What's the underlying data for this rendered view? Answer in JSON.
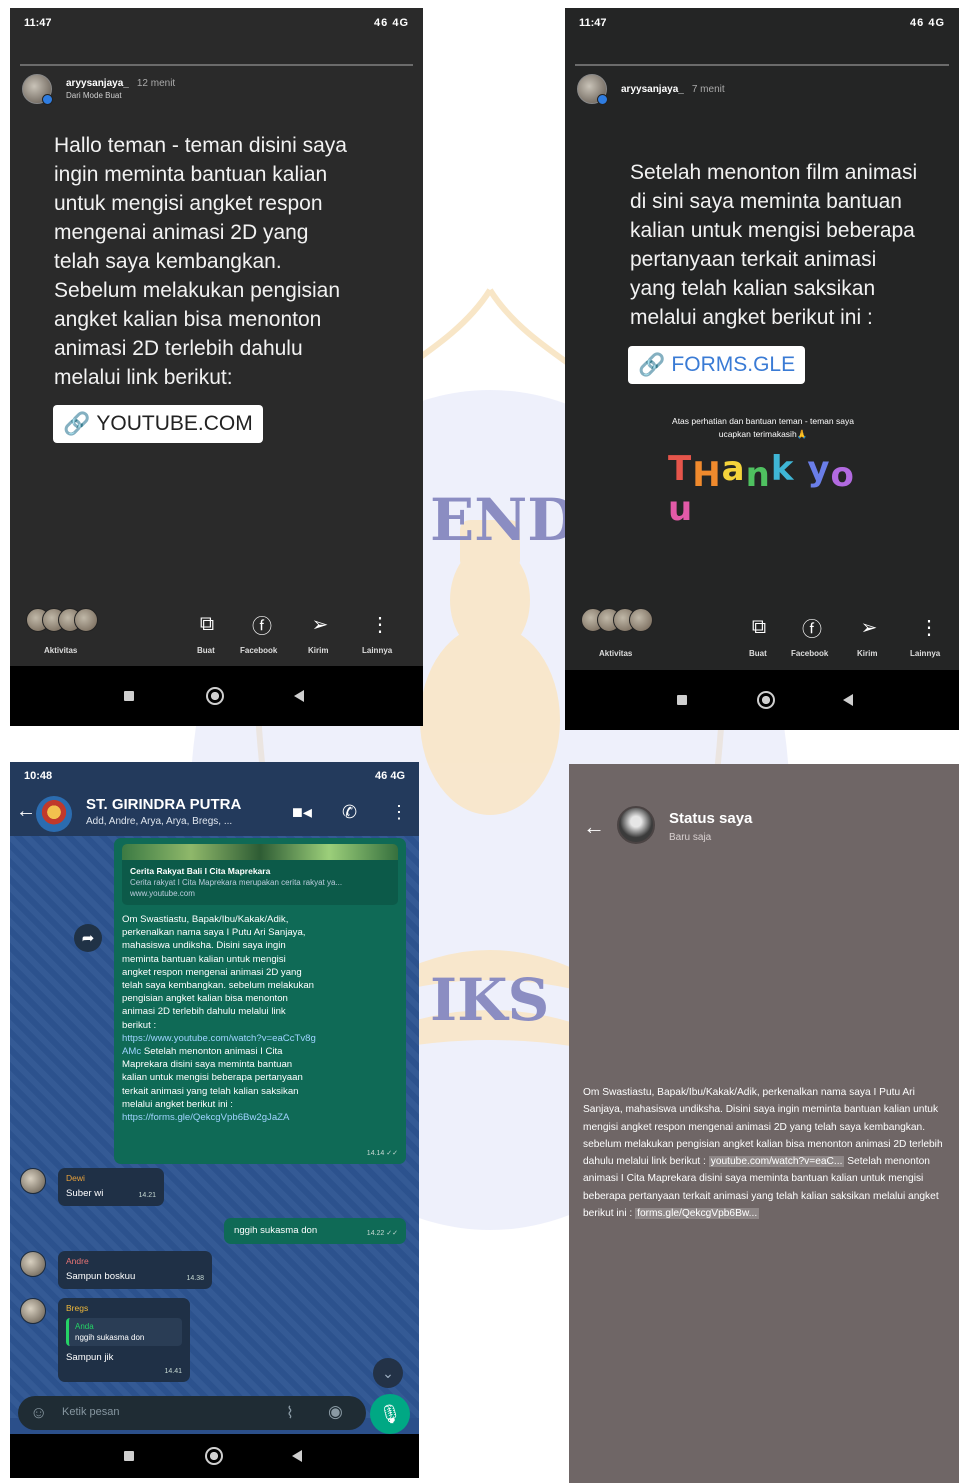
{
  "watermark": {
    "text_1": "ENDID",
    "text_2": "IKS"
  },
  "story1": {
    "status_time": "11:47",
    "status_right": "46 4G",
    "username": "aryysanjaya_",
    "time_ago": "12 menit",
    "subtitle": "Dari Mode Buat",
    "lines": [
      "Hallo teman - teman  disini saya",
      "ingin meminta bantuan kalian",
      "untuk mengisi angket respon",
      "mengenai animasi 2D yang",
      "telah saya kembangkan.",
      "Sebelum melakukan pengisian",
      "angket kalian bisa menonton",
      "animasi 2D terlebih dahulu",
      "melalui link berikut:"
    ],
    "link_label": "YOUTUBE.COM",
    "bar": {
      "activity": "Aktivitas",
      "create": "Buat",
      "facebook": "Facebook",
      "send": "Kirim",
      "more": "Lainnya"
    }
  },
  "story2": {
    "status_time": "11:47",
    "status_right": "46 4G",
    "username": "aryysanjaya_",
    "time_ago": "7 menit",
    "lines": [
      "Setelah menonton film animasi",
      "di sini saya meminta bantuan",
      "kalian untuk mengisi beberapa",
      "pertanyaan terkait animasi",
      "yang telah kalian saksikan",
      "melalui angket berikut ini :"
    ],
    "link_label": "FORMS.GLE",
    "thanks_line1": "Atas perhatian dan bantuan teman - teman saya",
    "thanks_line2": "ucapkan terimakasih🙏",
    "thank_you_letters": [
      "T",
      "H",
      "a",
      "n",
      "k",
      " ",
      "y",
      "o",
      "u"
    ],
    "thank_you_colors": [
      "#e5554b",
      "#f08a2d",
      "#f5d33b",
      "#4fc160",
      "#3fb6d6",
      "#ffffff",
      "#6a7ee8",
      "#b26ae0",
      "#e35aa8"
    ],
    "bar": {
      "activity": "Aktivitas",
      "create": "Buat",
      "facebook": "Facebook",
      "send": "Kirim",
      "more": "Lainnya"
    }
  },
  "whatsapp": {
    "status_time": "10:48",
    "status_right": "46 4G",
    "group_name": "ST. GIRINDRA PUTRA",
    "members": "Add, Andre, Arya, Arya, Bregs, ...",
    "preview_title": "Cerita Rakyat Bali I Cita Maprekara",
    "preview_desc": "Cerita rakyat I Cita Maprekara merupakan cerita rakyat ya...",
    "preview_url": "www.youtube.com",
    "main_message": [
      "Om Swastiastu, Bapak/Ibu/Kakak/Adik,",
      "perkenalkan nama saya I Putu Ari Sanjaya,",
      "mahasiswa undiksha. Disini saya ingin",
      "meminta bantuan kalian untuk mengisi",
      "angket respon mengenai animasi 2D yang",
      "telah saya kembangkan. sebelum melakukan",
      "pengisian angket kalian bisa menonton",
      "animasi 2D terlebih dahulu melalui link",
      "berikut :"
    ],
    "main_link1": "https://www.youtube.com/watch?v=eaCcTv8g",
    "main_link1b": "AMc",
    "main_message2": [
      " Setelah menonton animasi I Cita",
      "Maprekara disini saya meminta bantuan",
      "kalian untuk mengisi beberapa pertanyaan",
      "terkait animasi yang telah kalian saksikan",
      "melalui angket berikut ini :"
    ],
    "main_link2": "https://forms.gle/QekcgVpb6Bw2gJaZA",
    "main_time": "14.14 ✓✓",
    "msg_dewi_sender": "Dewi",
    "msg_dewi_text": "Suber wi",
    "msg_dewi_time": "14.21",
    "msg_reply_text": "nggih sukasma don",
    "msg_reply_time": "14.22 ✓✓",
    "msg_andre_sender": "Andre",
    "msg_andre_text": "Sampun boskuu",
    "msg_andre_time": "14.38",
    "msg_bregs_sender": "Bregs",
    "msg_bregs_quote_name": "Anda",
    "msg_bregs_quote_text": "nggih sukasma don",
    "msg_bregs_text": "Sampun jik",
    "msg_bregs_time": "14.41",
    "input_placeholder": "Ketik pesan"
  },
  "status": {
    "title": "Status saya",
    "subtitle": "Baru saja",
    "text_before_link1": "Om Swastiastu, Bapak/Ibu/Kakak/Adik, perkenalkan nama saya I Putu Ari Sanjaya, mahasiswa undiksha. Disini saya ingin meminta bantuan kalian untuk mengisi angket respon mengenai animasi 2D yang telah saya kembangkan. sebelum melakukan pengisian angket kalian bisa menonton animasi 2D terlebih dahulu melalui link berikut :",
    "link1": "youtube.com/watch?v=eaC...",
    "text_between": " Setelah menonton animasi I Cita Maprekara disini saya meminta bantuan kalian untuk mengisi beberapa pertanyaan terkait animasi yang telah kalian saksikan melalui angket berikut ini :",
    "link2": "forms.gle/QekcgVpb6Bw..."
  },
  "icons": {
    "back": "back-arrow-icon",
    "link": "link-chain-icon",
    "video": "video-call-icon",
    "phone": "phone-icon",
    "menu": "kebab-menu-icon",
    "emoji": "emoji-icon",
    "attach": "paperclip-icon",
    "camera": "camera-icon",
    "mic": "mic-icon"
  },
  "colors": {
    "story_bg": "#2a2a2a",
    "wa_header": "#233a5c",
    "wa_out_bubble": "#0f6a56",
    "wa_in_bubble": "#1f3046",
    "wa_mic": "#00a884",
    "status_bg": "#6f6666"
  }
}
